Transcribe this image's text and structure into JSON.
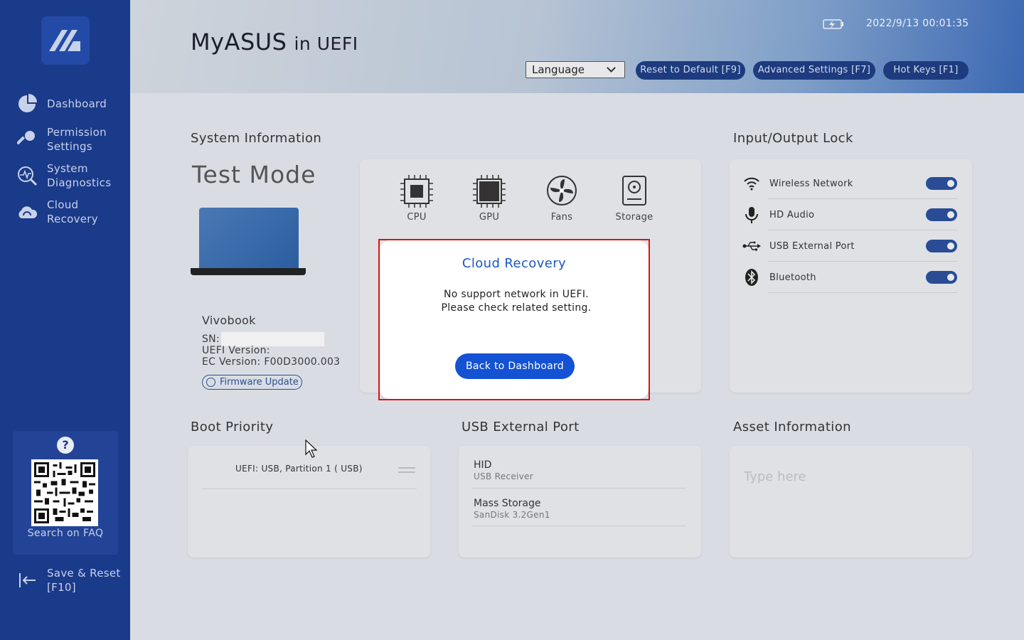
{
  "app": {
    "title_main": "MyASUS",
    "title_suffix": "in UEFI",
    "datetime": "2022/9/13 00:01:35"
  },
  "sidebar": {
    "items": [
      {
        "label": "Dashboard",
        "icon": "pie-chart-icon"
      },
      {
        "label": "Permission\nSettings",
        "icon": "key-icon"
      },
      {
        "label": "System\nDiagnostics",
        "icon": "diagnostics-icon"
      },
      {
        "label": "Cloud\nRecovery",
        "icon": "cloud-icon"
      }
    ],
    "faq_label": "Search on FAQ",
    "save_reset": "Save & Reset\n[F10]"
  },
  "header": {
    "language": "Language",
    "reset_btn": "Reset to Default [F9]",
    "advanced_btn": "Advanced Settings [F7]",
    "hotkeys_btn": "Hot Keys [F1]"
  },
  "system_info": {
    "section_title": "System Information",
    "mode": "Test Mode",
    "model": "Vivobook",
    "sn_label": "SN:",
    "uefi_label": "UEFI Version:",
    "ec_version": "EC Version: F00D3000.003",
    "firmware_btn": "Firmware Update",
    "hardware": [
      {
        "label": "CPU",
        "icon": "cpu-icon"
      },
      {
        "label": "GPU",
        "icon": "gpu-icon"
      },
      {
        "label": "Fans",
        "icon": "fan-icon"
      },
      {
        "label": "Storage",
        "icon": "storage-icon"
      }
    ]
  },
  "io_lock": {
    "section_title": "Input/Output Lock",
    "items": [
      {
        "label": "Wireless Network",
        "icon": "wifi-icon",
        "enabled": true
      },
      {
        "label": "HD Audio",
        "icon": "microphone-icon",
        "enabled": true
      },
      {
        "label": "USB External Port",
        "icon": "usb-icon",
        "enabled": true
      },
      {
        "label": "Bluetooth",
        "icon": "bluetooth-icon",
        "enabled": true
      }
    ]
  },
  "boot_priority": {
    "section_title": "Boot Priority",
    "items": [
      "UEFI:  USB, Partition 1 ( USB)"
    ]
  },
  "usb_port": {
    "section_title": "USB External Port",
    "devices": [
      {
        "name": "HID",
        "detail": "USB Receiver"
      },
      {
        "name": "Mass Storage",
        "detail": "SanDisk 3.2Gen1"
      }
    ]
  },
  "asset_info": {
    "section_title": "Asset Information",
    "placeholder": "Type here",
    "value": ""
  },
  "dialog": {
    "title": "Cloud Recovery",
    "message": "No support network in UEFI.\nPlease check related setting.",
    "button": "Back to Dashboard"
  },
  "colors": {
    "sidebar_bg": "#1a3a8a",
    "accent": "#1452d4",
    "toggle_on": "#2a4c95",
    "highlight_border": "#e01010"
  }
}
